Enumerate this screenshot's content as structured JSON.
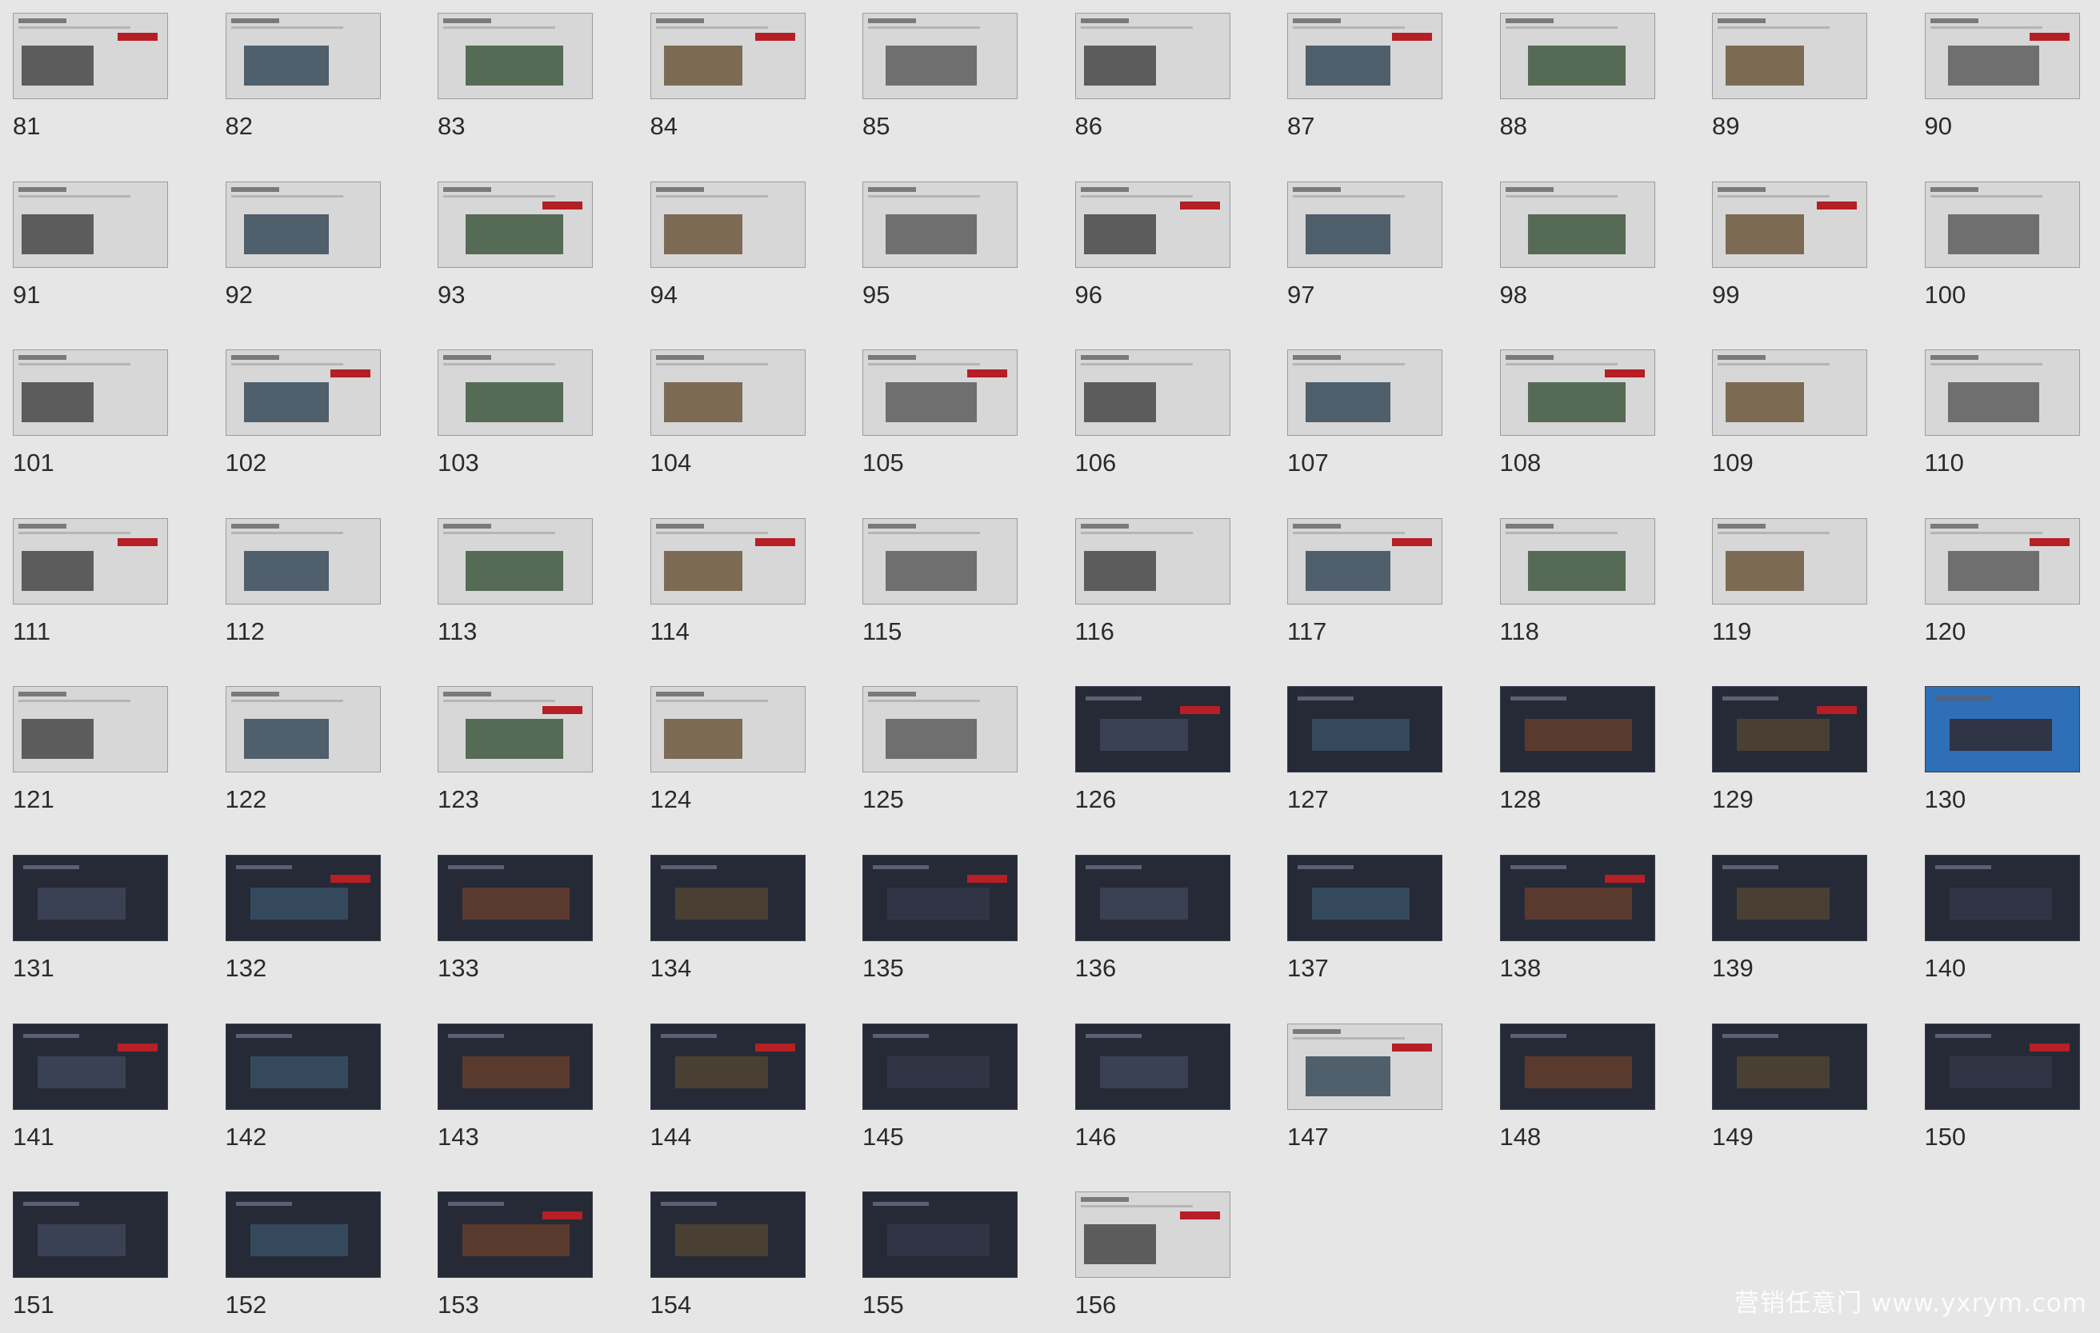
{
  "slides": [
    {
      "label": "81",
      "theme": "light"
    },
    {
      "label": "82",
      "theme": "light"
    },
    {
      "label": "83",
      "theme": "light"
    },
    {
      "label": "84",
      "theme": "light"
    },
    {
      "label": "85",
      "theme": "light"
    },
    {
      "label": "86",
      "theme": "light"
    },
    {
      "label": "87",
      "theme": "light"
    },
    {
      "label": "88",
      "theme": "light"
    },
    {
      "label": "89",
      "theme": "light"
    },
    {
      "label": "90",
      "theme": "light"
    },
    {
      "label": "91",
      "theme": "light"
    },
    {
      "label": "92",
      "theme": "light"
    },
    {
      "label": "93",
      "theme": "light"
    },
    {
      "label": "94",
      "theme": "light"
    },
    {
      "label": "95",
      "theme": "light"
    },
    {
      "label": "96",
      "theme": "light"
    },
    {
      "label": "97",
      "theme": "light"
    },
    {
      "label": "98",
      "theme": "light"
    },
    {
      "label": "99",
      "theme": "light"
    },
    {
      "label": "100",
      "theme": "light"
    },
    {
      "label": "101",
      "theme": "light"
    },
    {
      "label": "102",
      "theme": "light"
    },
    {
      "label": "103",
      "theme": "light"
    },
    {
      "label": "104",
      "theme": "light"
    },
    {
      "label": "105",
      "theme": "light"
    },
    {
      "label": "106",
      "theme": "light"
    },
    {
      "label": "107",
      "theme": "light"
    },
    {
      "label": "108",
      "theme": "light"
    },
    {
      "label": "109",
      "theme": "light"
    },
    {
      "label": "110",
      "theme": "light"
    },
    {
      "label": "111",
      "theme": "light"
    },
    {
      "label": "112",
      "theme": "light"
    },
    {
      "label": "113",
      "theme": "light"
    },
    {
      "label": "114",
      "theme": "light"
    },
    {
      "label": "115",
      "theme": "light"
    },
    {
      "label": "116",
      "theme": "light"
    },
    {
      "label": "117",
      "theme": "light"
    },
    {
      "label": "118",
      "theme": "light"
    },
    {
      "label": "119",
      "theme": "light"
    },
    {
      "label": "120",
      "theme": "light"
    },
    {
      "label": "121",
      "theme": "light"
    },
    {
      "label": "122",
      "theme": "light"
    },
    {
      "label": "123",
      "theme": "light"
    },
    {
      "label": "124",
      "theme": "light"
    },
    {
      "label": "125",
      "theme": "light"
    },
    {
      "label": "126",
      "theme": "dark"
    },
    {
      "label": "127",
      "theme": "dark"
    },
    {
      "label": "128",
      "theme": "dark"
    },
    {
      "label": "129",
      "theme": "dark"
    },
    {
      "label": "130",
      "theme": "blue"
    },
    {
      "label": "131",
      "theme": "dark"
    },
    {
      "label": "132",
      "theme": "dark"
    },
    {
      "label": "133",
      "theme": "dark"
    },
    {
      "label": "134",
      "theme": "dark"
    },
    {
      "label": "135",
      "theme": "dark"
    },
    {
      "label": "136",
      "theme": "dark"
    },
    {
      "label": "137",
      "theme": "dark"
    },
    {
      "label": "138",
      "theme": "dark"
    },
    {
      "label": "139",
      "theme": "dark"
    },
    {
      "label": "140",
      "theme": "dark"
    },
    {
      "label": "141",
      "theme": "dark"
    },
    {
      "label": "142",
      "theme": "dark"
    },
    {
      "label": "143",
      "theme": "dark"
    },
    {
      "label": "144",
      "theme": "dark"
    },
    {
      "label": "145",
      "theme": "dark"
    },
    {
      "label": "146",
      "theme": "dark"
    },
    {
      "label": "147",
      "theme": "light"
    },
    {
      "label": "148",
      "theme": "dark"
    },
    {
      "label": "149",
      "theme": "dark"
    },
    {
      "label": "150",
      "theme": "dark"
    },
    {
      "label": "151",
      "theme": "dark"
    },
    {
      "label": "152",
      "theme": "dark"
    },
    {
      "label": "153",
      "theme": "dark"
    },
    {
      "label": "154",
      "theme": "dark"
    },
    {
      "label": "155",
      "theme": "dark"
    },
    {
      "label": "156",
      "theme": "light"
    }
  ],
  "watermark": "营销任意门 www.yxrym.com",
  "colors": {
    "background": "#e6e6e6",
    "light_slide": "#d7d7d7",
    "dark_slide": "#262a36",
    "accent_red": "#b51f25",
    "accent_blue": "#2e6fb7",
    "label_text": "#2b2b2b"
  }
}
